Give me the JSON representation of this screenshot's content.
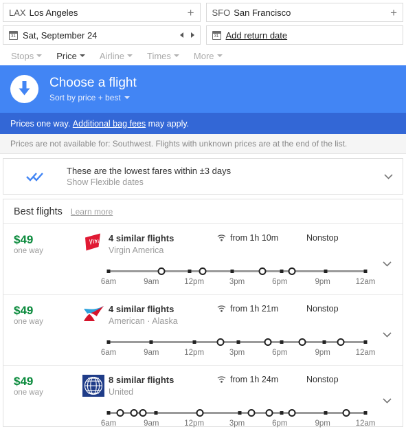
{
  "search": {
    "origin": {
      "code": "LAX",
      "city": "Los Angeles",
      "add_icon": "plus-icon"
    },
    "destination": {
      "code": "SFO",
      "city": "San Francisco",
      "add_icon": "plus-icon"
    },
    "depart_date": "Sat, September 24",
    "return_label": "Add return date",
    "prev_label": "◀",
    "next_label": "▶"
  },
  "filters": [
    {
      "label": "Stops",
      "active": false
    },
    {
      "label": "Price",
      "active": true
    },
    {
      "label": "Airline",
      "active": false
    },
    {
      "label": "Times",
      "active": false
    },
    {
      "label": "More",
      "active": false
    }
  ],
  "banner": {
    "icon": "download-arrow-icon",
    "title": "Choose a flight",
    "sort_label": "Sort by price + best",
    "bg_color": "#4285F4"
  },
  "prices_bar": {
    "prefix": "Prices one way.",
    "link": "Additional bag fees",
    "suffix": "may apply.",
    "bg_color": "#3367D6"
  },
  "notice": {
    "text": "Prices are not available for: Southwest. Flights with unknown prices are at the end of the list."
  },
  "flexible": {
    "icon": "double-check-icon",
    "icon_color": "#4285F4",
    "title": "These are the lowest fares within ±3 days",
    "subtitle": "Show Flexible dates",
    "expand_icon": "chevron-down-icon"
  },
  "best_flights": {
    "heading": "Best flights",
    "learn_more": "Learn more"
  },
  "time_labels": [
    "6am",
    "9am",
    "12pm",
    "3pm",
    "6pm",
    "9pm",
    "12am"
  ],
  "flights": [
    {
      "price": "$49",
      "price_note": "one way",
      "price_color": "#0A8A3C",
      "logo": "virgin-america-logo",
      "similar": "4 similar flights",
      "carriers": "Virgin America",
      "wifi_icon": "wifi-icon",
      "duration": "from 1h 10m",
      "stops": "Nonstop",
      "expand_icon": "chevron-down-icon",
      "departures": [
        {
          "pos": 0.0,
          "type": "dot"
        },
        {
          "pos": 0.205,
          "type": "circle"
        },
        {
          "pos": 0.315,
          "type": "dot"
        },
        {
          "pos": 0.365,
          "type": "circle"
        },
        {
          "pos": 0.48,
          "type": "dot"
        },
        {
          "pos": 0.6,
          "type": "circle"
        },
        {
          "pos": 0.675,
          "type": "dot"
        },
        {
          "pos": 0.715,
          "type": "circle"
        },
        {
          "pos": 0.845,
          "type": "dot"
        },
        {
          "pos": 1.0,
          "type": "dot"
        }
      ]
    },
    {
      "price": "$49",
      "price_note": "one way",
      "price_color": "#0A8A3C",
      "logo": "american-airlines-logo",
      "similar": "4 similar flights",
      "carriers": "American · Alaska",
      "wifi_icon": "wifi-icon",
      "duration": "from 1h 21m",
      "stops": "Nonstop",
      "expand_icon": "chevron-down-icon",
      "departures": [
        {
          "pos": 0.0,
          "type": "dot"
        },
        {
          "pos": 0.165,
          "type": "dot"
        },
        {
          "pos": 0.335,
          "type": "dot"
        },
        {
          "pos": 0.435,
          "type": "circle"
        },
        {
          "pos": 0.505,
          "type": "dot"
        },
        {
          "pos": 0.62,
          "type": "circle"
        },
        {
          "pos": 0.675,
          "type": "dot"
        },
        {
          "pos": 0.755,
          "type": "circle"
        },
        {
          "pos": 0.84,
          "type": "dot"
        },
        {
          "pos": 0.905,
          "type": "circle"
        },
        {
          "pos": 1.0,
          "type": "dot"
        }
      ]
    },
    {
      "price": "$49",
      "price_note": "one way",
      "price_color": "#0A8A3C",
      "logo": "united-airlines-logo",
      "similar": "8 similar flights",
      "carriers": "United",
      "wifi_icon": "wifi-icon",
      "duration": "from 1h 24m",
      "stops": "Nonstop",
      "expand_icon": "chevron-down-icon",
      "departures": [
        {
          "pos": 0.0,
          "type": "dot"
        },
        {
          "pos": 0.045,
          "type": "circle"
        },
        {
          "pos": 0.1,
          "type": "circle"
        },
        {
          "pos": 0.135,
          "type": "circle"
        },
        {
          "pos": 0.185,
          "type": "dot"
        },
        {
          "pos": 0.355,
          "type": "circle"
        },
        {
          "pos": 0.51,
          "type": "dot"
        },
        {
          "pos": 0.555,
          "type": "circle"
        },
        {
          "pos": 0.625,
          "type": "circle"
        },
        {
          "pos": 0.675,
          "type": "dot"
        },
        {
          "pos": 0.715,
          "type": "circle"
        },
        {
          "pos": 0.845,
          "type": "dot"
        },
        {
          "pos": 0.925,
          "type": "circle"
        },
        {
          "pos": 1.0,
          "type": "dot"
        }
      ]
    }
  ]
}
